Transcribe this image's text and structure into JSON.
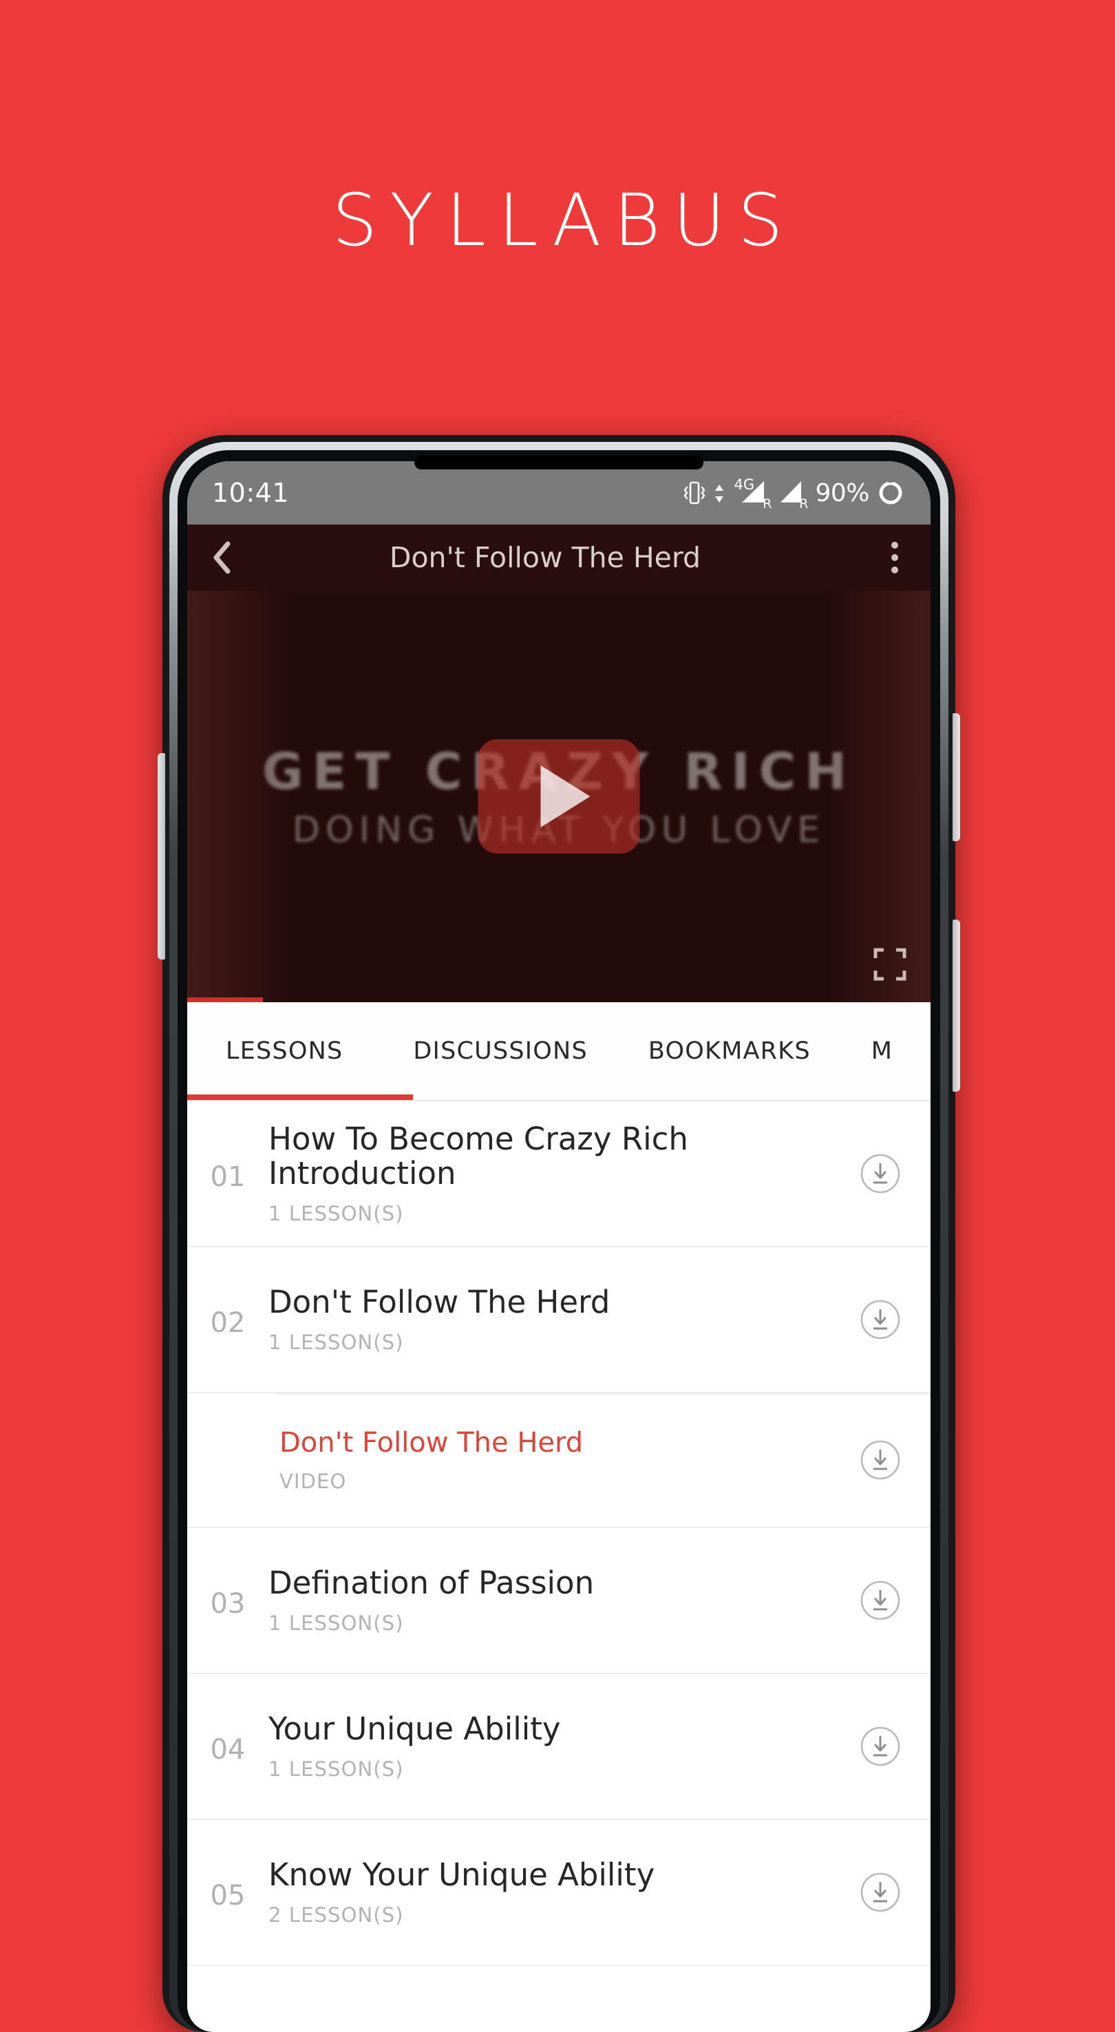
{
  "poster": {
    "title": "SYLLABUS",
    "background_color": "#ee3a3a"
  },
  "status_bar": {
    "time": "10:41",
    "network_label": "4G",
    "roaming_label": "R",
    "battery_percent": "90%",
    "icons": [
      "vibrate-icon",
      "data-transfer-icon",
      "signal-4g-icon",
      "signal-bars-icon",
      "battery-icon"
    ]
  },
  "app_bar": {
    "back_icon": "chevron-left-icon",
    "title": "Don't Follow The Herd",
    "overflow_icon": "more-vertical-icon"
  },
  "video": {
    "headline": "GET CRAZY RICH",
    "subheadline": "DOING WHAT YOU LOVE",
    "play_icon": "play-icon",
    "fullscreen_icon": "fullscreen-icon",
    "accent_color": "#cf3027"
  },
  "tabs": {
    "items": [
      {
        "label": "LESSONS",
        "active": true
      },
      {
        "label": "DISCUSSIONS",
        "active": false
      },
      {
        "label": "BOOKMARKS",
        "active": false
      },
      {
        "label": "M",
        "active": false
      }
    ],
    "active_color": "#e03a30"
  },
  "lessons": [
    {
      "number": "01",
      "title": "How To Become Crazy Rich Introduction",
      "subtitle": "1 LESSON(S)",
      "download_icon": "download-icon",
      "type": "section"
    },
    {
      "number": "02",
      "title": "Don't Follow The Herd",
      "subtitle": "1 LESSON(S)",
      "download_icon": "download-icon",
      "type": "section"
    },
    {
      "number": "",
      "title": "Don't Follow The Herd",
      "subtitle": "VIDEO",
      "download_icon": "download-icon",
      "type": "lesson"
    },
    {
      "number": "03",
      "title": "Defination of Passion",
      "subtitle": "1 LESSON(S)",
      "download_icon": "download-icon",
      "type": "section"
    },
    {
      "number": "04",
      "title": "Your Unique Ability",
      "subtitle": "1 LESSON(S)",
      "download_icon": "download-icon",
      "type": "section"
    },
    {
      "number": "05",
      "title": "Know Your Unique Ability",
      "subtitle": "2 LESSON(S)",
      "download_icon": "download-icon",
      "type": "section"
    }
  ]
}
